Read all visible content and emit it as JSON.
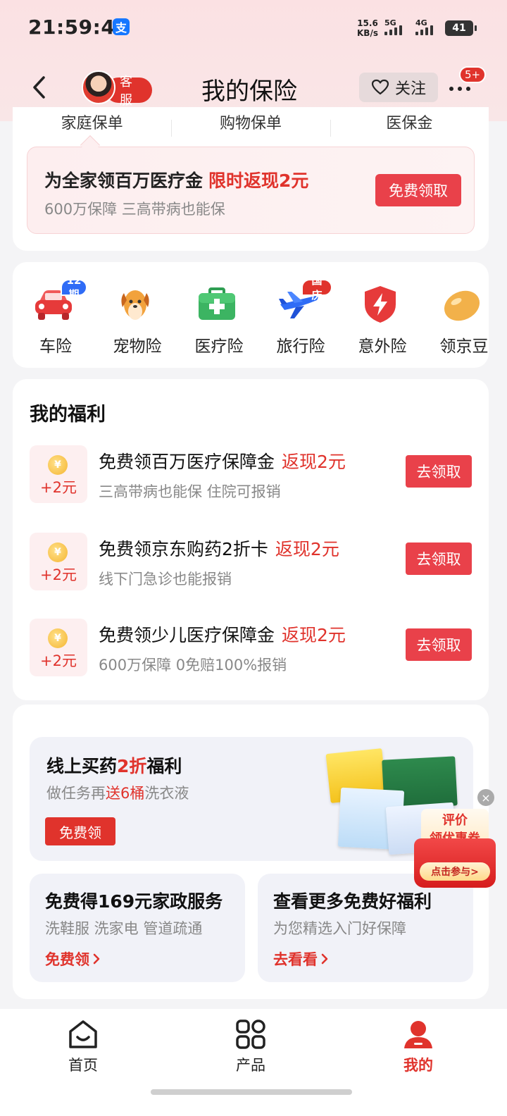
{
  "status_bar": {
    "time": "21:59:40",
    "app_badge": "支",
    "net_speed_value": "15.6",
    "net_speed_unit": "KB/s",
    "signal_1": "5G",
    "signal_2": "4G",
    "battery": "41"
  },
  "header": {
    "back_icon": "chevron-left-icon",
    "customer_service_label": "客服",
    "title": "我的保险",
    "follow_label": "关注",
    "more_icon": "more-dots-icon",
    "message_badge": "5+"
  },
  "policy_tabs": [
    {
      "label": "家庭保单"
    },
    {
      "label": "购物保单"
    },
    {
      "label": "医保金"
    }
  ],
  "promo": {
    "title": "为全家领百万医疗金",
    "highlight": "限时返现2元",
    "subtitle": "600万保障 三高带病也能保",
    "button": "免费领取"
  },
  "categories": [
    {
      "label": "车险",
      "icon": "car-icon",
      "badge": "12期",
      "badge_color": "#2f6cf6"
    },
    {
      "label": "宠物险",
      "icon": "dog-icon",
      "badge": "",
      "badge_color": ""
    },
    {
      "label": "医疗险",
      "icon": "medical-kit-icon",
      "badge": "",
      "badge_color": ""
    },
    {
      "label": "旅行险",
      "icon": "airplane-icon",
      "badge": "国庆",
      "badge_color": "#e0332c"
    },
    {
      "label": "意外险",
      "icon": "shield-bolt-icon",
      "badge": "",
      "badge_color": ""
    },
    {
      "label": "领京豆",
      "icon": "bean-icon",
      "badge": "",
      "badge_color": ""
    }
  ],
  "welfare": {
    "title": "我的福利",
    "items": [
      {
        "amount": "+2元",
        "title": "免费领百万医疗保障金",
        "highlight": "返现2元",
        "subtitle": "三高带病也能保 住院可报销",
        "button": "去领取"
      },
      {
        "amount": "+2元",
        "title": "免费领京东购药2折卡",
        "highlight": "返现2元",
        "subtitle": "线下门急诊也能报销",
        "button": "去领取"
      },
      {
        "amount": "+2元",
        "title": "免费领少儿医疗保障金",
        "highlight": "返现2元",
        "subtitle": "600万保障 0免赔100%报销",
        "button": "去领取"
      }
    ]
  },
  "medicine": {
    "title_prefix": "线上买药",
    "title_highlight": "2折",
    "title_suffix": "福利",
    "sub_prefix": "做任务再",
    "sub_highlight": "送6桶",
    "sub_suffix": "洗衣液",
    "button": "免费领"
  },
  "half_cards": [
    {
      "title": "免费得169元家政服务",
      "subtitle": "洗鞋服 洗家电 管道疏通",
      "link": "免费领"
    },
    {
      "title": "查看更多免费好福利",
      "subtitle": "为您精选入门好保障",
      "link": "去看看"
    }
  ],
  "float_coupon": {
    "line1": "评价",
    "line2": "领优惠券",
    "cta": "点击参与>",
    "close_icon": "close-icon"
  },
  "tabbar": [
    {
      "label": "首页",
      "icon": "home-icon",
      "active": false
    },
    {
      "label": "产品",
      "icon": "grid-icon",
      "active": false
    },
    {
      "label": "我的",
      "icon": "user-icon",
      "active": true
    }
  ],
  "colors": {
    "accent": "#e0332c",
    "button": "#e9414a",
    "header_bg": "#fbe1e3",
    "page_bg": "#f4f4f6"
  }
}
